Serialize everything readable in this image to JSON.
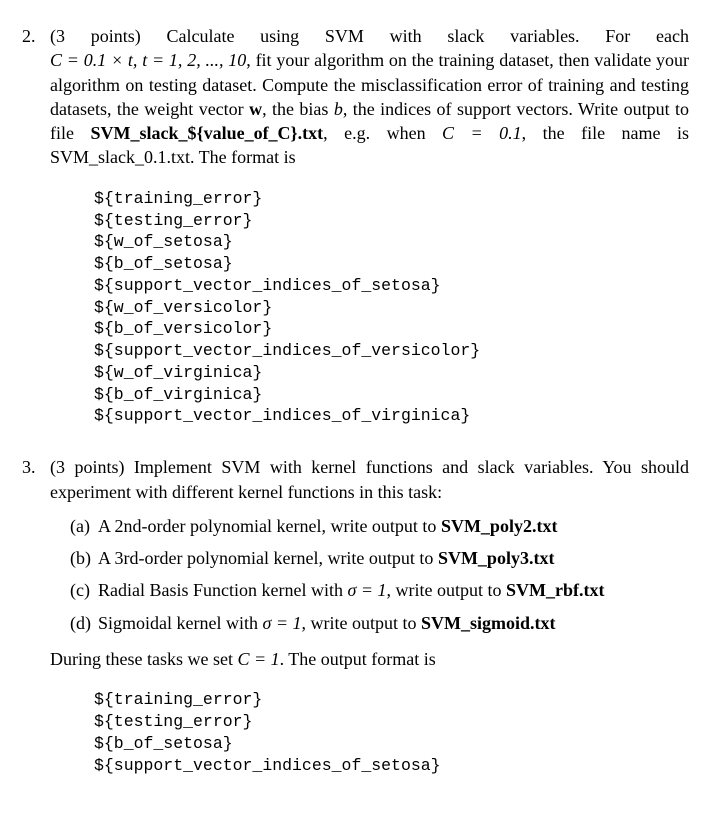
{
  "p2": {
    "num": "2.",
    "points": "(3 points)",
    "intro_a": " Calculate using SVM with slack variables. For each ",
    "C_eq": "C = 0.1 × t, t = 1, 2, ..., 10",
    "intro_b": ", fit your algorithm on the training dataset, then validate your algorithm on testing dataset. Compute the misclassification error of training and testing datasets, the weight vector ",
    "w": "w",
    "intro_c": ", the bias ",
    "b": "b",
    "intro_d": ", the indices of support vectors. Write output to file ",
    "file_pattern": "SVM_slack_${value_of_C}.txt",
    "intro_e": ", e.g. when ",
    "C_01": "C = 0.1",
    "intro_f": ", the file name is SVM_slack_0.1.txt. The format is",
    "code": "${training_error}\n${testing_error}\n${w_of_setosa}\n${b_of_setosa}\n${support_vector_indices_of_setosa}\n${w_of_versicolor}\n${b_of_versicolor}\n${support_vector_indices_of_versicolor}\n${w_of_virginica}\n${b_of_virginica}\n${support_vector_indices_of_virginica}"
  },
  "p3": {
    "num": "3.",
    "points": "(3 points)",
    "intro": " Implement SVM with kernel functions and slack variables. You should experiment with different kernel functions in this task:",
    "a": {
      "label": "(a)",
      "text": "A 2nd-order polynomial kernel, write output to ",
      "file": "SVM_poly2.txt"
    },
    "b": {
      "label": "(b)",
      "text": "A 3rd-order polynomial kernel, write output to ",
      "file": "SVM_poly3.txt"
    },
    "c": {
      "label": "(c)",
      "text_a": "Radial Basis Function kernel with ",
      "sigma": "σ = 1",
      "text_b": ", write output to ",
      "file": "SVM_rbf.txt"
    },
    "d": {
      "label": "(d)",
      "text_a": "Sigmoidal kernel with ",
      "sigma": "σ = 1",
      "text_b": ", write output to ",
      "file": "SVM_sigmoid.txt"
    },
    "after_a": "During these tasks we set ",
    "C1": "C = 1",
    "after_b": ". The output format is",
    "code": "${training_error}\n${testing_error}\n${b_of_setosa}\n${support_vector_indices_of_setosa}"
  }
}
